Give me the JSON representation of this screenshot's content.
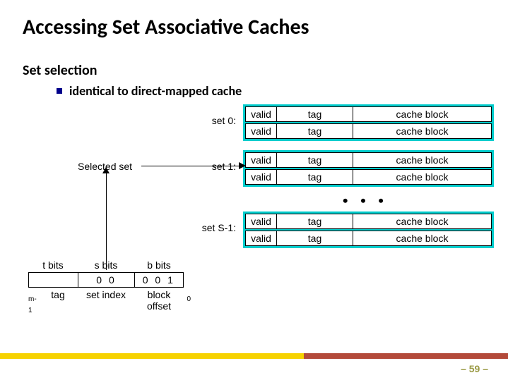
{
  "title": "Accessing Set Associative Caches",
  "subtitle": "Set selection",
  "bullet": "identical to direct-mapped cache",
  "selected_label": "Selected set",
  "sets": [
    {
      "label": "set 0:"
    },
    {
      "label": "set 1:"
    },
    {
      "label": "set S-1:"
    }
  ],
  "line_cols": {
    "valid": "valid",
    "tag": "tag",
    "block": "cache block"
  },
  "dots": "• • •",
  "addr": {
    "t_label": "t bits",
    "s_label": "s bits",
    "b_label": "b bits",
    "s_value": "0 0",
    "b_value": "0 0 1",
    "tag_label": "tag",
    "setindex_label": "set index",
    "blockoffset_label": "block offset",
    "m1": "m-1",
    "zero": "0"
  },
  "page": "– 59 –"
}
